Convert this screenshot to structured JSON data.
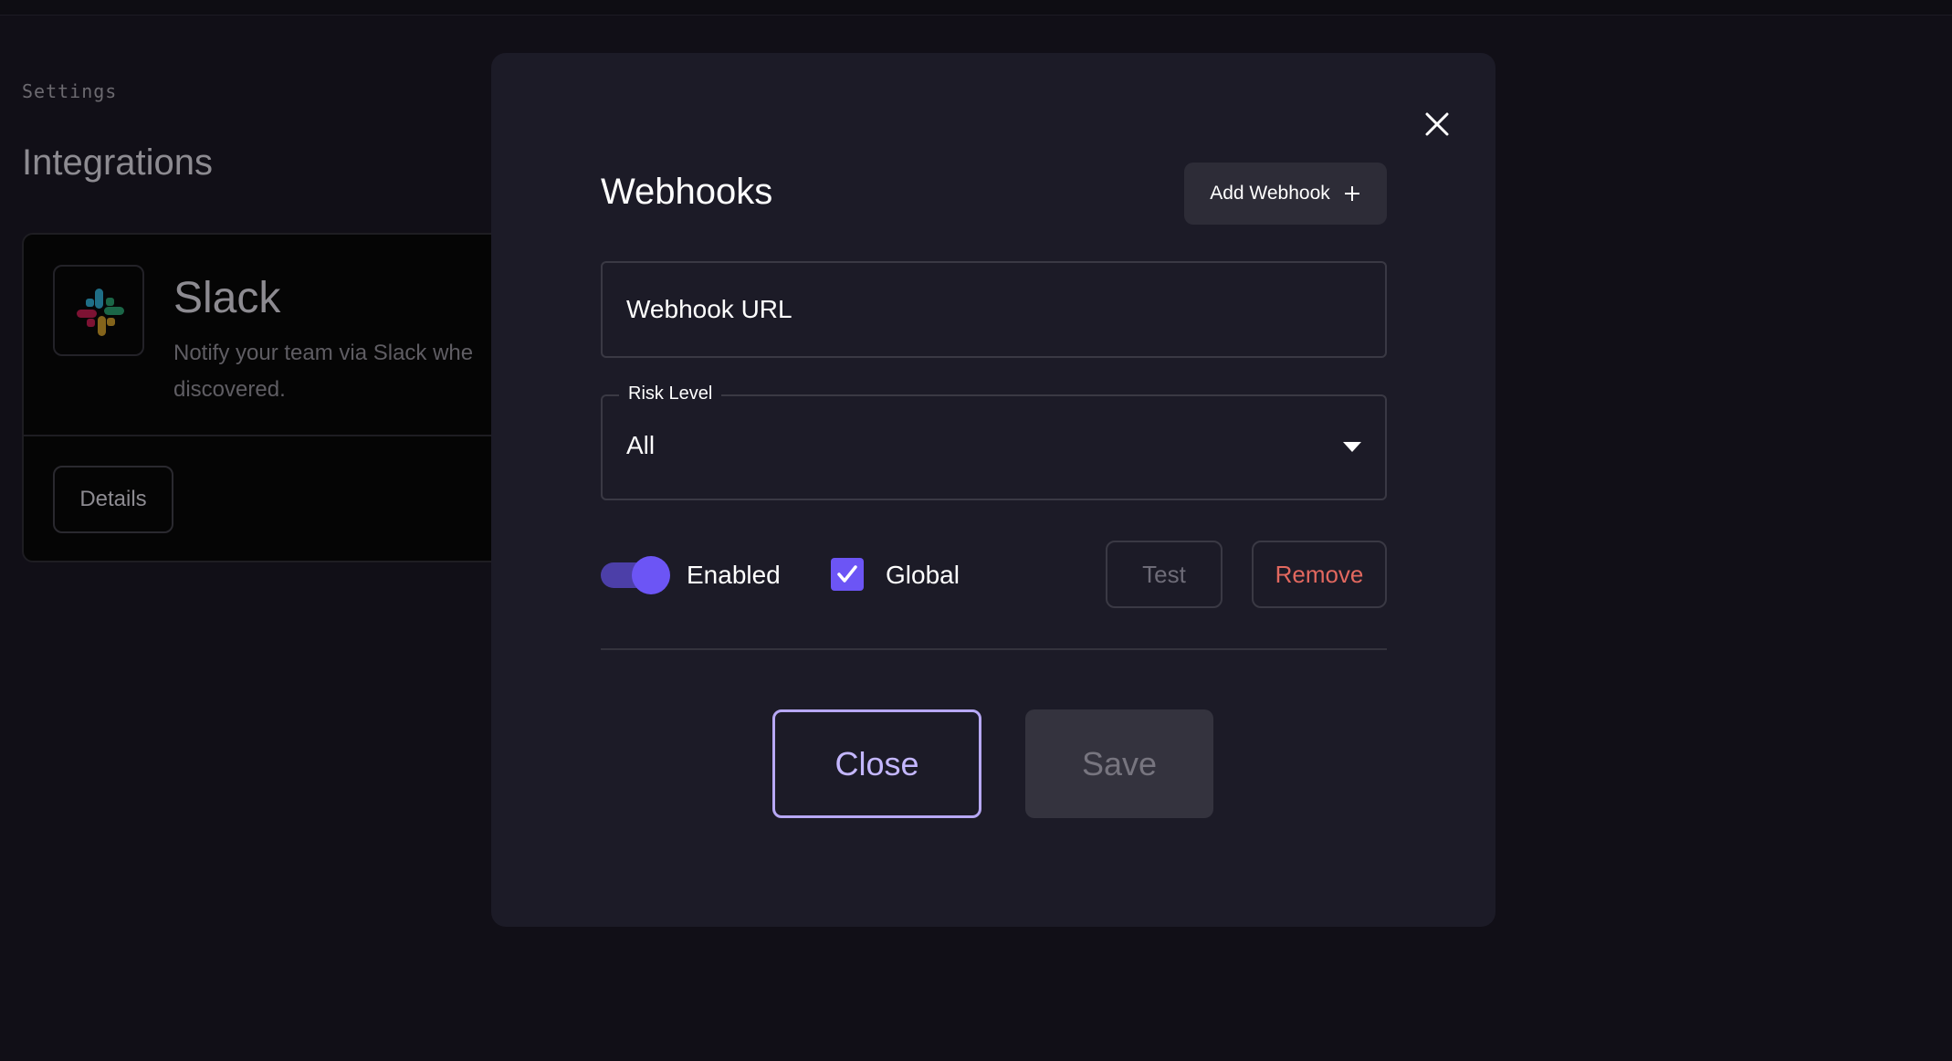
{
  "background": {
    "breadcrumb": "Settings",
    "page_title": "Integrations",
    "card": {
      "logo_icon": "slack-logo-icon",
      "name": "Slack",
      "description": "Notify your team via Slack whe discovered.",
      "description_line1": "Notify your team via Slack whe",
      "description_line2": "discovered.",
      "details_label": "Details"
    }
  },
  "modal": {
    "title": "Webhooks",
    "close_icon": "close-icon",
    "add_webhook_label": "Add Webhook",
    "add_icon": "plus-icon",
    "webhook_url": {
      "placeholder": "Webhook URL",
      "value": ""
    },
    "risk_level": {
      "label": "Risk Level",
      "selected": "All"
    },
    "enabled": {
      "label": "Enabled",
      "checked": true
    },
    "global": {
      "label": "Global",
      "checked": true
    },
    "test_label": "Test",
    "remove_label": "Remove",
    "close_label": "Close",
    "save_label": "Save"
  },
  "colors": {
    "accent": "#6c55f5",
    "danger": "#e2685f",
    "modal_bg": "#1c1b27",
    "page_bg": "#110f17"
  }
}
